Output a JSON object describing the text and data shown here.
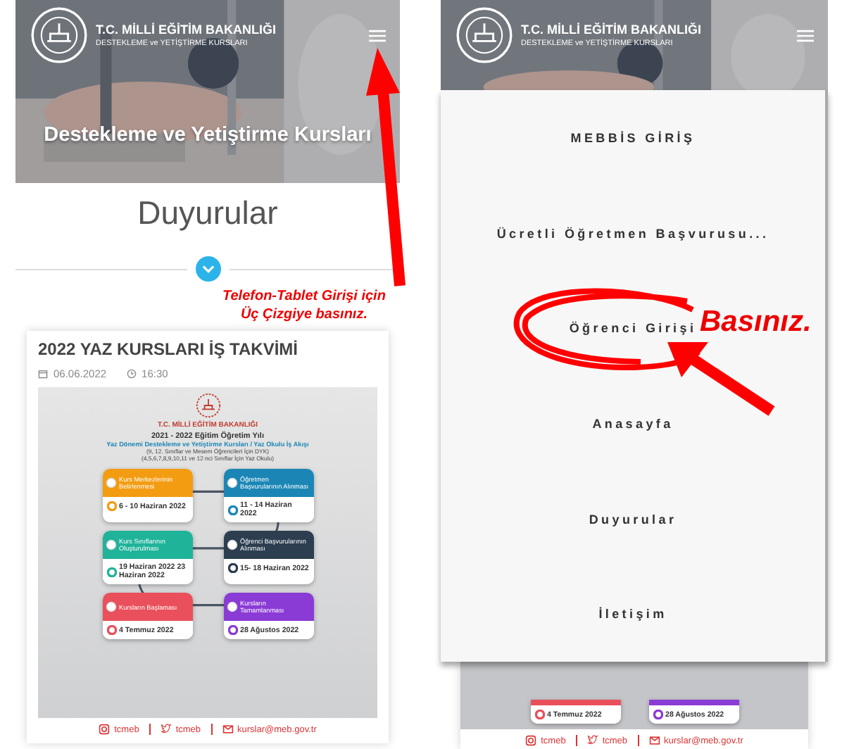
{
  "left_screen": {
    "header": {
      "title": "T.C. MİLLİ EĞİTİM BAKANLIĞI",
      "subtitle": "DESTEKLEME ve YETİŞTİRME KURSLARI"
    },
    "hero_title": "Destekleme ve Yetiştirme Kursları",
    "section_title": "Duyurular",
    "post": {
      "title": "2022 YAZ KURSLARI İŞ TAKVİMİ",
      "date": "06.06.2022",
      "time": "16:30",
      "poster": {
        "org": "T.C. MİLLİ EĞİTİM BAKANLIĞI",
        "year": "2021 - 2022 Eğitim Öğretim Yılı",
        "subtitle": "Yaz Dönemi Destekleme ve Yetiştirme Kursları / Yaz Okulu İş Akışı",
        "notes": [
          "(9, 12. Sınıflar ve Mesem Öğrencileri İçin DYK)",
          "(4,5,6,7,8,9,10,11 ve 12 nci Sınıflar İçin Yaz Okulu)"
        ],
        "step_rows": [
          [
            {
              "title": "Kurs Merkezlerinin Belirlenmesi",
              "date": "6 - 10 Haziran 2022",
              "color": "#f39c12"
            },
            {
              "title": "Öğretmen Başvurularının Alınması",
              "date": "11 - 14 Haziran 2022",
              "color": "#1b86b5"
            }
          ],
          [
            {
              "title": "Kurs Sınıflarının Oluşturulması",
              "date": "19 Haziran 2022 23 Haziran 2022",
              "color": "#1fb39a"
            },
            {
              "title": "Öğrenci Başvurularının Alınması",
              "date": "15- 18 Haziran 2022",
              "color": "#2c3e50"
            }
          ],
          [
            {
              "title": "Kursların Başlaması",
              "date": "4 Temmuz 2022",
              "color": "#e9505c"
            },
            {
              "title": "Kursların Tamamlanması",
              "date": "28 Ağustos 2022",
              "color": "#8a3bd6"
            }
          ]
        ],
        "links": [
          {
            "kind": "instagram",
            "label": "tcmeb"
          },
          {
            "kind": "twitter",
            "label": "tcmeb"
          },
          {
            "kind": "email",
            "label": "kurslar@meb.gov.tr"
          }
        ]
      }
    }
  },
  "left_annotation": {
    "lines": [
      "Telefon-Tablet Girişi için",
      "Üç Çizgiye basınız."
    ]
  },
  "right_screen": {
    "header": {
      "title": "T.C. MİLLİ EĞİTİM BAKANLIĞI",
      "subtitle": "DESTEKLEME ve YETİŞTİRME KURSLARI"
    },
    "menu": [
      "MEBBİS GİRİŞ",
      "Ücretli Öğretmen Başvurusu...",
      "Öğrenci Girişi",
      "Anasayfa",
      "Duyurular",
      "İletişim"
    ],
    "poster_bottom": {
      "steps": [
        {
          "date": "4 Temmuz 2022",
          "color": "#e9505c"
        },
        {
          "date": "28 Ağustos 2022",
          "color": "#8a3bd6"
        }
      ],
      "links": [
        {
          "kind": "instagram",
          "label": "tcmeb"
        },
        {
          "kind": "twitter",
          "label": "tcmeb"
        },
        {
          "kind": "email",
          "label": "kurslar@meb.gov.tr"
        }
      ]
    }
  },
  "right_annotation": {
    "text": "Basınız."
  }
}
